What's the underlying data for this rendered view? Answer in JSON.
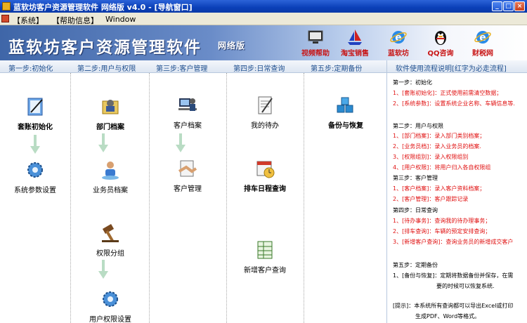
{
  "window": {
    "title": "蓝软坊客户资源管理软件 网络版 v4.0 - [导航窗口]",
    "controls": {
      "minimize": "_",
      "maximize": "□",
      "close": "×"
    }
  },
  "menubar": {
    "items": [
      "【系统】",
      "【帮助信息】",
      "Window"
    ]
  },
  "banner": {
    "title": "蓝软坊客户资源管理软件",
    "edition": "网络版",
    "links": [
      {
        "label": "视频帮助",
        "icon": "video-icon"
      },
      {
        "label": "淘宝销售",
        "icon": "sailboat-icon"
      },
      {
        "label": "蓝软坊",
        "icon": "ie-icon"
      },
      {
        "label": "QQ咨询",
        "icon": "qq-penguin-icon"
      },
      {
        "label": "财税网",
        "icon": "ie-icon"
      }
    ]
  },
  "steps": [
    {
      "label": "第一步:初始化"
    },
    {
      "label": "第二步:用户与权限"
    },
    {
      "label": "第三步:客户管理"
    },
    {
      "label": "第四步:日常查询"
    },
    {
      "label": "第五步:定期备份"
    }
  ],
  "modules": {
    "account_init": "套账初始化",
    "system_params": "系统参数设置",
    "department_archive": "部门档案",
    "salesman_archive": "业务员档案",
    "permission_group": "权限分组",
    "user_permission": "用户权限设置",
    "customer_archive": "客户档案",
    "customer_management": "客户管理",
    "my_todo": "我的待办",
    "schedule_query": "排车日程查询",
    "new_customer_query": "新增客户查询",
    "backup_restore": "备份与恢复"
  },
  "info": {
    "header": "软件使用流程说明[红字为必走流程]",
    "lines": [
      {
        "text": "第一步：初始化",
        "color": "#000000"
      },
      {
        "text": "1、[套账初始化]：正式使用前需清空数据；",
        "color": "#e01010"
      },
      {
        "text": "2、[系统参数]：设置系统企业名称、车辆信息等.",
        "color": "#e01010"
      },
      {
        "text": "第二步：用户与权限",
        "color": "#000000"
      },
      {
        "text": "1、[部门档案]：录入部门类别档案；",
        "color": "#e01010"
      },
      {
        "text": "2、[业务员档]：录入业务员的档案.",
        "color": "#e01010"
      },
      {
        "text": "3、[权限组别]：录入权限组别",
        "color": "#e01010"
      },
      {
        "text": "4、[用户权限]：将用户归入各自权限组",
        "color": "#e01010"
      },
      {
        "text": "第三步：客户管理",
        "color": "#000000"
      },
      {
        "text": "1、[客户档案]：录入客户资料档案；",
        "color": "#e01010"
      },
      {
        "text": "2、[客户管理]：客户跟踪记录",
        "color": "#e01010"
      },
      {
        "text": "第四步：日常查询",
        "color": "#000000"
      },
      {
        "text": "1、[待办事务]：查询我的待办理事务；",
        "color": "#e01010"
      },
      {
        "text": "2、[排车查询]：车辆的预定安排查询；",
        "color": "#e01010"
      },
      {
        "text": "3、[新增客户查询]：查询业务员的新增成交客户",
        "color": "#e01010"
      },
      {
        "text": "第五步：定期备份",
        "color": "#000000"
      },
      {
        "text": "1、[备份与恢复]：定期将数据备份并保存，在需",
        "color": "#000000"
      },
      {
        "text": "要的时候可以恢复系统.",
        "color": "#000000"
      },
      {
        "text": "[提示]：本系统所有查询都可以导出Excel或打印",
        "color": "#000000"
      },
      {
        "text": "生成PDF、Word等格式。",
        "color": "#000000"
      }
    ]
  }
}
